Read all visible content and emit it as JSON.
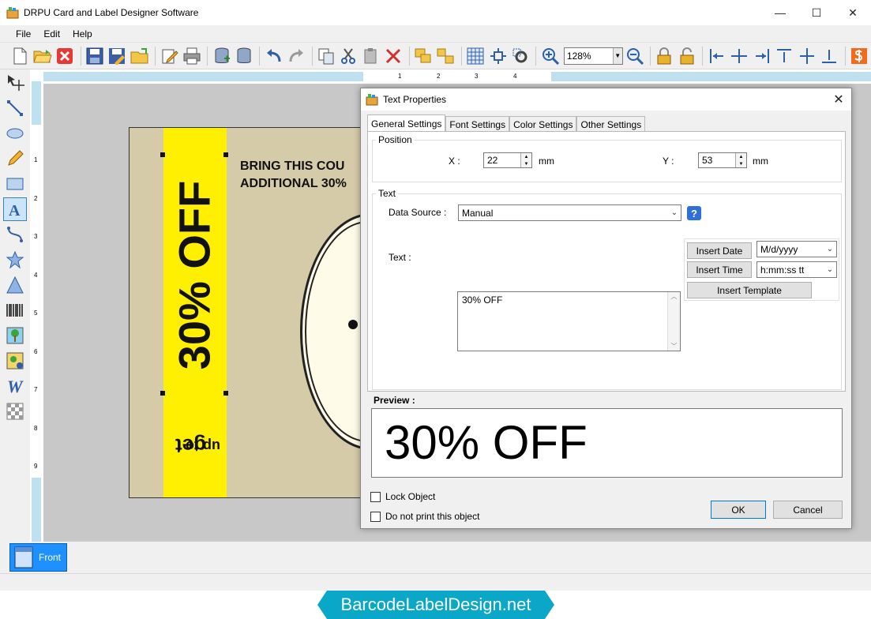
{
  "app": {
    "title": "DRPU Card and Label Designer Software"
  },
  "window_controls": {
    "minimize": "—",
    "maximize": "☐",
    "close": "✕"
  },
  "menu": [
    {
      "label": "File"
    },
    {
      "label": "Edit"
    },
    {
      "label": "Help"
    }
  ],
  "toolbar": {
    "zoom": "128%"
  },
  "ruler": {
    "top": [
      "1",
      "2",
      "3",
      "4"
    ],
    "left": [
      "1",
      "2",
      "3",
      "4",
      "5",
      "6",
      "7",
      "8",
      "9"
    ]
  },
  "card": {
    "vertical_text": "30% OFF",
    "get_line1": "get",
    "get_line2": "up to",
    "bring_line1": "BRING THIS COU",
    "bring_line2": "ADDITIONAL 30%"
  },
  "bottom": {
    "front_tab": "Front"
  },
  "watermark": "BarcodeLabelDesign.net",
  "dialog": {
    "title": "Text Properties",
    "tabs": [
      "General Settings",
      "Font Settings",
      "Color Settings",
      "Other Settings"
    ],
    "position": {
      "legend": "Position",
      "x_label": "X :",
      "x_value": "22",
      "x_unit": "mm",
      "y_label": "Y :",
      "y_value": "53",
      "y_unit": "mm"
    },
    "text_group": {
      "legend": "Text",
      "data_source_label": "Data Source :",
      "data_source_value": "Manual",
      "text_label": "Text :",
      "text_value": "30% OFF",
      "insert_date": "Insert Date",
      "date_format": "M/d/yyyy",
      "insert_time": "Insert Time",
      "time_format": "h:mm:ss tt",
      "insert_template": "Insert Template"
    },
    "preview_label": "Preview :",
    "preview_text": "30% OFF",
    "lock_object": "Lock Object",
    "do_not_print": "Do not print this object",
    "ok": "OK",
    "cancel": "Cancel"
  }
}
